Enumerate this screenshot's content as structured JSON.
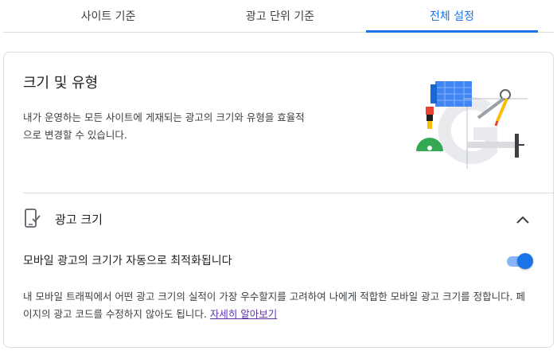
{
  "tabs": [
    {
      "label": "사이트 기준"
    },
    {
      "label": "광고 단위 기준"
    },
    {
      "label": "전체 설정"
    }
  ],
  "active_tab": "전체 설정",
  "section": {
    "title": "크기 및 유형",
    "description": "내가 운영하는 모든 사이트에 게재되는 광고의 크기와 유형을 효율적으로 변경할 수 있습니다."
  },
  "ad_size": {
    "title": "광고 크기",
    "setting_label": "모바일 광고의 크기가 자동으로 최적화됩니다",
    "toggle_on": true,
    "help_text": "내 모바일 트래픽에서 어떤 광고 크기의 실적이 가장 우수할지를 고려하여 나에게 적합한 모바일 광고 크기를 정합니다. 페이지의 광고 코드를 수정하지 않아도 됩니다.",
    "learn_more": "자세히 알아보기"
  },
  "colors": {
    "accent": "#1a73e8",
    "link": "#5e35b1",
    "border": "#dadce0"
  },
  "icons": {
    "section": "phone-check-icon",
    "collapse": "chevron-up-icon",
    "illustration": "design-tools-illustration"
  }
}
